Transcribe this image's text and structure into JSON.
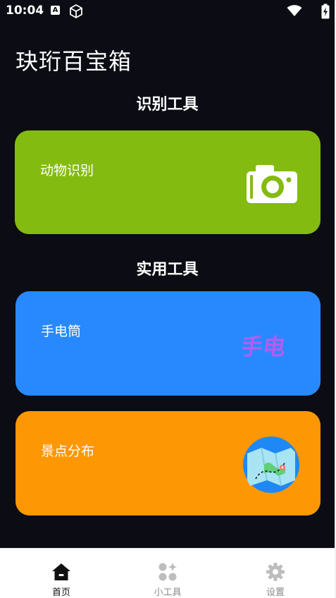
{
  "status_bar": {
    "time": "10:04",
    "notification_letter": "A",
    "icons": [
      "a-notification-icon",
      "cube-icon",
      "wifi-icon",
      "battery-charging-icon"
    ]
  },
  "app": {
    "title": "玦珩百宝箱"
  },
  "sections": [
    {
      "title": "识别工具",
      "cards": [
        {
          "label": "动物识别",
          "icon": "camera-icon",
          "color": "#84bb10"
        }
      ]
    },
    {
      "title": "实用工具",
      "cards": [
        {
          "label": "手电筒",
          "icon": "flashlight-text-icon",
          "icon_text": "手电",
          "color": "#2889fe"
        },
        {
          "label": "景点分布",
          "icon": "map-globe-icon",
          "color": "#fe9704"
        }
      ]
    }
  ],
  "bottom_nav": {
    "items": [
      {
        "label": "首页",
        "icon": "home-icon",
        "active": true
      },
      {
        "label": "小工具",
        "icon": "widgets-icon",
        "active": false
      },
      {
        "label": "设置",
        "icon": "settings-gear-icon",
        "active": false
      }
    ]
  },
  "colors": {
    "background": "#0b0c14",
    "card_green": "#84bb10",
    "card_blue": "#2889fe",
    "card_orange": "#fe9704",
    "torch_text": "#b45cf0",
    "nav_active": "#111111",
    "nav_inactive": "#8a8a8a"
  }
}
